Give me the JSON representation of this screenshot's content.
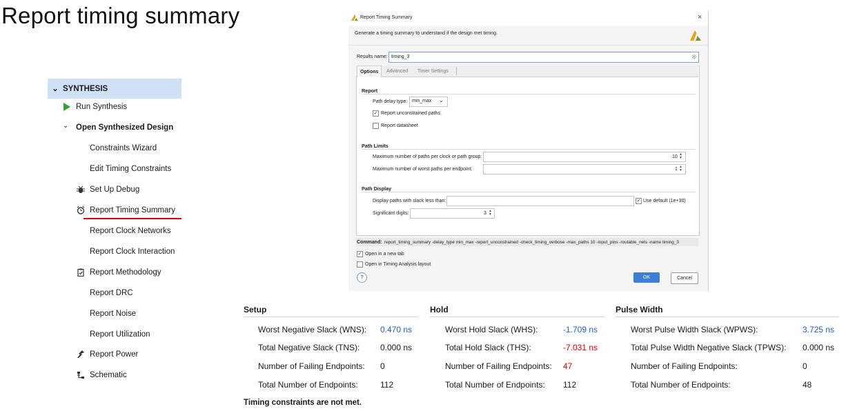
{
  "slide_title": "Report timing summary",
  "nav": {
    "section": "SYNTHESIS",
    "items": [
      {
        "label": "Run Synthesis",
        "icon": "play-icon"
      },
      {
        "label": "Open Synthesized Design",
        "icon": "chevron-down-icon"
      },
      {
        "label": "Constraints Wizard"
      },
      {
        "label": "Edit Timing Constraints"
      },
      {
        "label": "Set Up Debug",
        "icon": "bug-icon"
      },
      {
        "label": "Report Timing Summary",
        "icon": "clock-icon"
      },
      {
        "label": "Report Clock Networks"
      },
      {
        "label": "Report Clock Interaction"
      },
      {
        "label": "Report Methodology",
        "icon": "clipboard-icon"
      },
      {
        "label": "Report DRC"
      },
      {
        "label": "Report Noise"
      },
      {
        "label": "Report Utilization"
      },
      {
        "label": "Report Power",
        "icon": "power-icon"
      },
      {
        "label": "Schematic",
        "icon": "schematic-icon"
      }
    ]
  },
  "dialog": {
    "title": "Report Timing Summary",
    "description": "Generate a timing summary to understand if the design met timing.",
    "results_name_label": "Results name:",
    "results_name_value": "timing_3",
    "tabs": [
      "Options",
      "Advanced",
      "Timer Settings"
    ],
    "report_header": "Report",
    "path_delay_label": "Path delay type:",
    "path_delay_value": "min_max",
    "report_unconstrained": "Report unconstrained paths",
    "report_datasheet": "Report datasheet",
    "path_limits_header": "Path Limits",
    "max_paths_label": "Maximum number of paths per clock or path group:",
    "max_paths_value": "10",
    "max_worst_label": "Maximum number of worst paths per endpoint:",
    "max_worst_value": "1",
    "path_display_header": "Path Display",
    "display_slack_label": "Display paths with slack less than:",
    "use_default_label": "Use default (1e+30)",
    "sig_digits_label": "Significant digits:",
    "sig_digits_value": "3",
    "command_label": "Command:",
    "command_value": "report_timing_summary -delay_type min_max -report_unconstrained -check_timing_verbose -max_paths 10 -input_pins -routable_nets -name timing_3",
    "open_new_tab": "Open in a new tab",
    "open_timing_layout": "Open in Timing Analysis layout",
    "help": "?",
    "ok": "OK",
    "cancel": "Cancel",
    "close": "×"
  },
  "summary": {
    "setup": {
      "title": "Setup",
      "rows": [
        {
          "label": "Worst Negative Slack (WNS):",
          "value": "0.470 ns"
        },
        {
          "label": "Total Negative Slack (TNS):",
          "value": "0.000 ns"
        },
        {
          "label": "Number of Failing Endpoints:",
          "value": "0"
        },
        {
          "label": "Total Number of Endpoints:",
          "value": "112"
        }
      ]
    },
    "hold": {
      "title": "Hold",
      "rows": [
        {
          "label": "Worst Hold Slack (WHS):",
          "value": "-1.709 ns"
        },
        {
          "label": "Total Hold Slack (THS):",
          "value": "-7.031 ns"
        },
        {
          "label": "Number of Failing Endpoints:",
          "value": "47"
        },
        {
          "label": "Total Number of Endpoints:",
          "value": "112"
        }
      ]
    },
    "pulse": {
      "title": "Pulse Width",
      "rows": [
        {
          "label": "Worst Pulse Width Slack (WPWS):",
          "value": "3.725 ns"
        },
        {
          "label": "Total Pulse Width Negative Slack (TPWS):",
          "value": "0.000 ns"
        },
        {
          "label": "Number of Failing Endpoints:",
          "value": "0"
        },
        {
          "label": "Total Number of Endpoints:",
          "value": "48"
        }
      ]
    },
    "status": "Timing constraints are not met."
  },
  "colors": {
    "nav_highlight": "#cfe0f7",
    "accent_blue": "#1f5fd6",
    "error_red": "#e00000",
    "run_green": "#2ea52e",
    "ok_button": "#3d7fd9"
  }
}
